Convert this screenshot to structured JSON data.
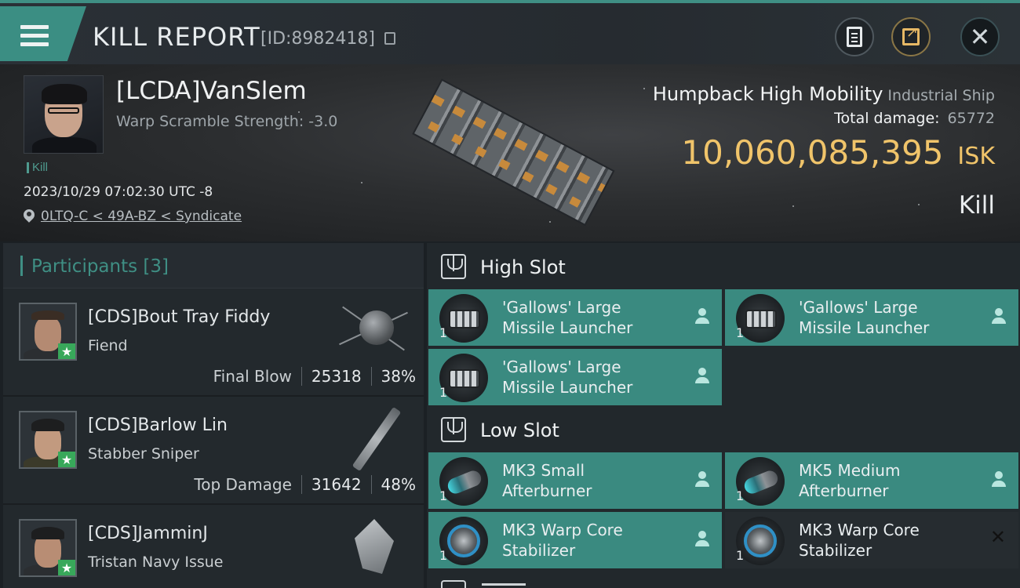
{
  "header": {
    "title": "KILL REPORT",
    "report_id": "[ID:8982418]"
  },
  "victim": {
    "name": "[LCDA]VanSlem",
    "warp_scramble": "Warp Scramble Strength: -3.0",
    "result_tag": "Kill",
    "timestamp": "2023/10/29 07:02:30 UTC -8",
    "location": "0LTQ-C < 49A-BZ < Syndicate",
    "ship_name": "Humpback High Mobility",
    "ship_class": "Industrial Ship",
    "total_damage_label": "Total damage:",
    "total_damage": "65772",
    "isk_value": "10,060,085,395",
    "isk_unit": "ISK",
    "outcome": "Kill"
  },
  "participants": {
    "label": "Participants",
    "count": "[3]",
    "list": [
      {
        "name": "[CDS]Bout Tray Fiddy",
        "ship": "Fiend",
        "role": "Final Blow",
        "damage": "25318",
        "percent": "38%",
        "star": "★"
      },
      {
        "name": "[CDS]Barlow Lin",
        "ship": "Stabber Sniper",
        "role": "Top Damage",
        "damage": "31642",
        "percent": "48%",
        "star": "★"
      },
      {
        "name": "[CDS]JamminJ",
        "ship": "Tristan Navy Issue",
        "star": "★"
      }
    ]
  },
  "slots": {
    "high": {
      "title": "High Slot",
      "items": [
        {
          "name_line1": "'Gallows' Large",
          "name_line2": "Missile Launcher",
          "qty": "1",
          "icon": "missile-launcher-icon"
        },
        {
          "name_line1": "'Gallows' Large",
          "name_line2": "Missile Launcher",
          "qty": "1",
          "icon": "missile-launcher-icon"
        },
        {
          "name_line1": "'Gallows' Large",
          "name_line2": "Missile Launcher",
          "qty": "1",
          "icon": "missile-launcher-icon"
        }
      ]
    },
    "low": {
      "title": "Low Slot",
      "items": [
        {
          "name_line1": "MK3 Small",
          "name_line2": "Afterburner",
          "qty": "1",
          "icon": "afterburner-icon"
        },
        {
          "name_line1": "MK5 Medium",
          "name_line2": "Afterburner",
          "qty": "1",
          "icon": "afterburner-icon"
        },
        {
          "name_line1": "MK3 Warp Core",
          "name_line2": "Stabilizer",
          "qty": "1",
          "icon": "warp-core-stabilizer-icon"
        },
        {
          "name_line1": "MK3 Warp Core",
          "name_line2": "Stabilizer",
          "qty": "1",
          "icon": "warp-core-stabilizer-icon",
          "status": "destroyed"
        }
      ]
    }
  },
  "colors": {
    "accent": "#3f8f84",
    "isk": "#f0c46a",
    "final_blow_star": "#38a85a"
  }
}
